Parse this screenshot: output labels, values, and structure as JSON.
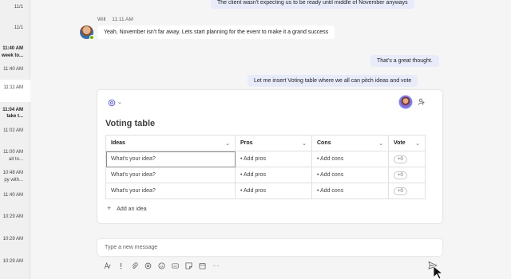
{
  "chat_list": [
    {
      "text": "11/1",
      "bold": false
    },
    {
      "text": "11/1",
      "bold": false
    },
    {
      "text": "11:40 AM",
      "bold": true
    },
    {
      "text": "week to...",
      "bold": true
    },
    {
      "text": "11:40 AM",
      "bold": false
    },
    {
      "text": "11:11 AM",
      "bold": false
    },
    {
      "text": "11:04 AM",
      "bold": true
    },
    {
      "text": "take t...",
      "bold": true
    },
    {
      "text": "11:02 AM",
      "bold": false
    },
    {
      "text": "11:00 AM",
      "bold": false
    },
    {
      "text": "ait to...",
      "bold": false
    },
    {
      "text": "10:48 AM",
      "bold": false
    },
    {
      "text": "py with...",
      "bold": false
    },
    {
      "text": "11:40 AM",
      "bold": false
    },
    {
      "text": "10:29 AM",
      "bold": false
    },
    {
      "text": "10:29 AM",
      "bold": false
    },
    {
      "text": "10:29 AM",
      "bold": false
    }
  ],
  "messages": {
    "out_top": "The client wasn't expecting us to be ready until middle of November anyways",
    "in_sender": "Will",
    "in_time": "11:11 AM",
    "in_text": "Yeah, November isn't far away. Lets start planning for the event to make it a grand success",
    "out_1": "That's a great thought.",
    "out_2": "Let me insert Voting table where we all can pitch ideas and vote"
  },
  "card": {
    "title": "Voting table",
    "columns": [
      "Ideas",
      "Pros",
      "Cons",
      "Vote"
    ],
    "rows": [
      {
        "idea": "What's your idea?",
        "pros": "• Add pros",
        "cons": "• Add cons",
        "vote": "+0"
      },
      {
        "idea": "What's your idea?",
        "pros": "• Add pros",
        "cons": "• Add cons",
        "vote": "+0"
      },
      {
        "idea": "What's your idea?",
        "pros": "• Add pros",
        "cons": "• Add cons",
        "vote": "+0"
      }
    ],
    "add_idea": "Add an idea",
    "dropdown_glyph": "⌄",
    "header_chevron": "⌄"
  },
  "compose": {
    "placeholder": "Type a new message"
  },
  "toolbar": {
    "icons": [
      "format-icon",
      "priority-icon",
      "attach-icon",
      "loop-icon",
      "emoji-icon",
      "gif-icon",
      "sticker-icon",
      "schedule-icon",
      "more-icon"
    ],
    "gif_label": "GIF",
    "more_label": "···"
  },
  "colors": {
    "accent": "#5b5fc7",
    "outgoing_bubble": "#e8ebfa",
    "presence": "#6bb700"
  }
}
